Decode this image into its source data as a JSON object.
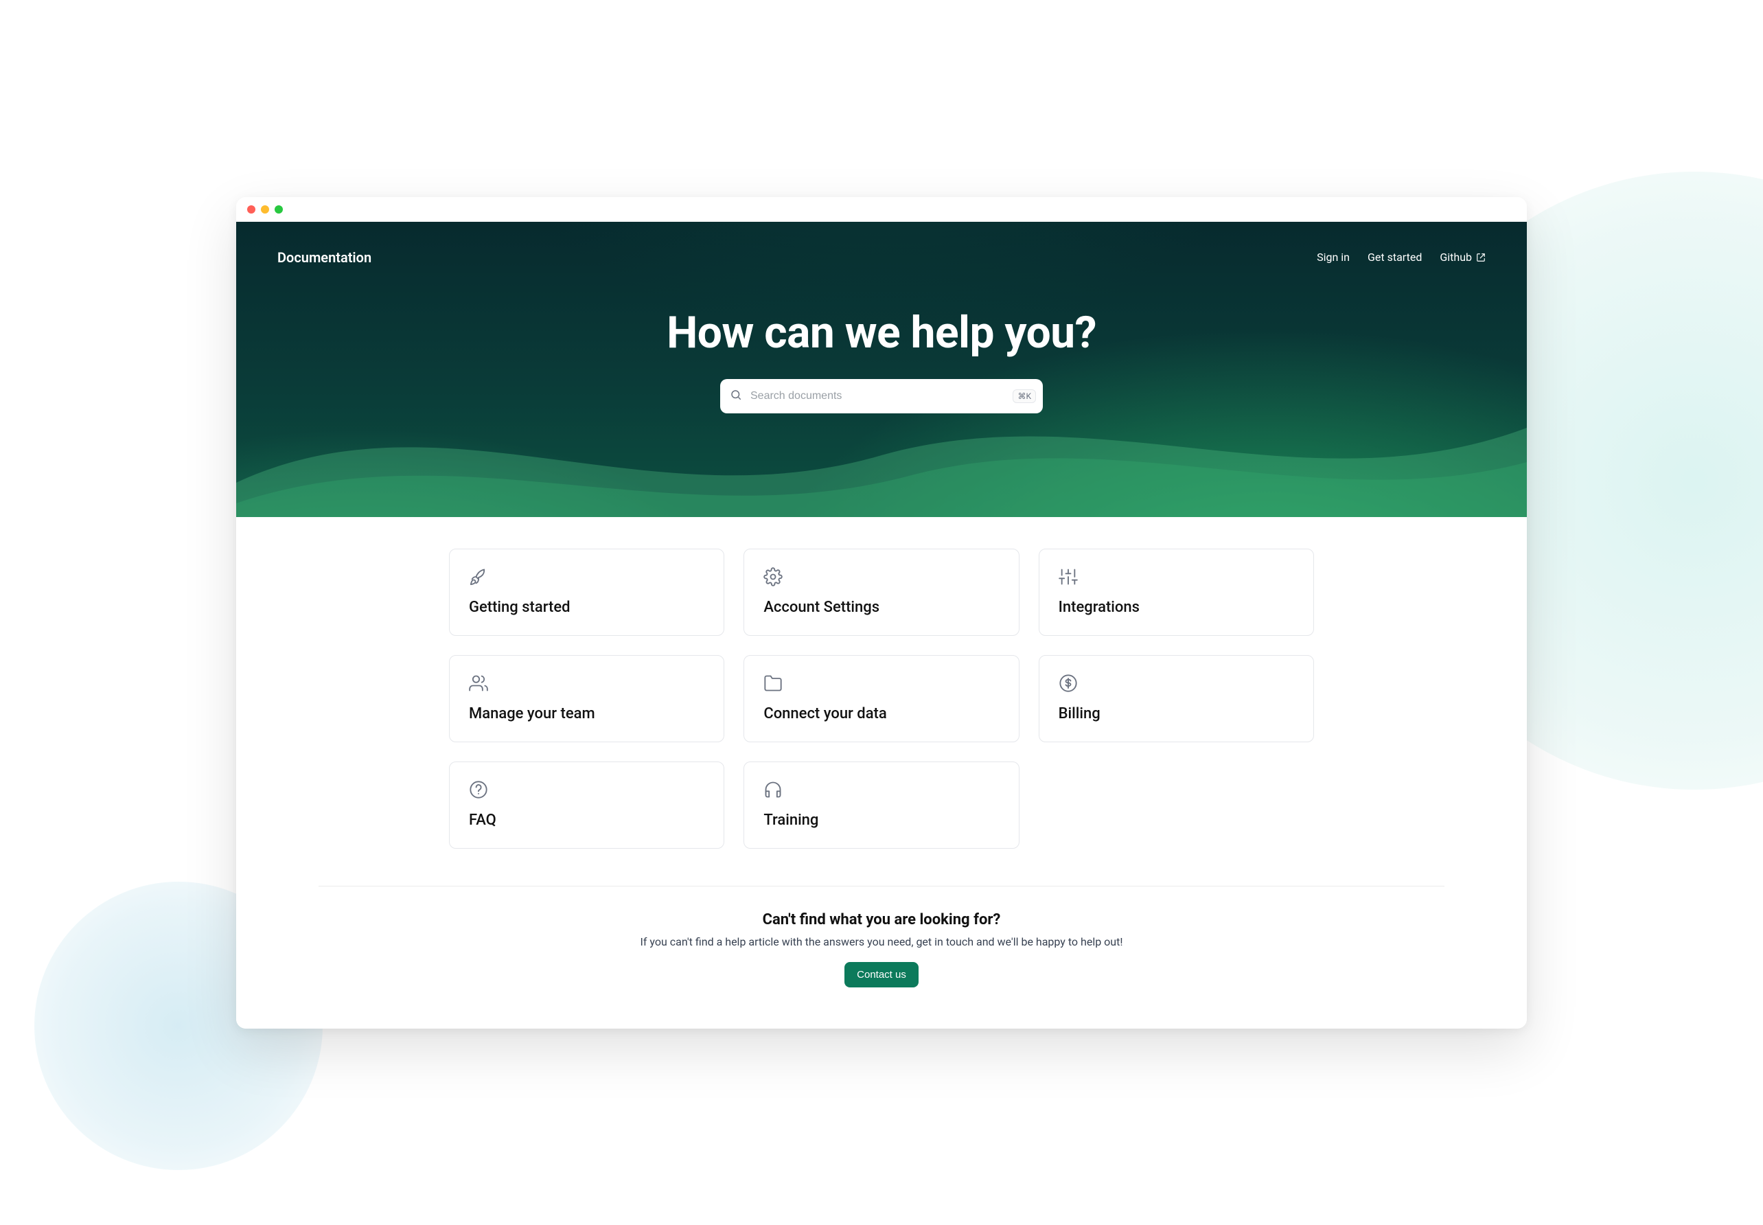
{
  "header": {
    "brand": "Documentation",
    "nav": {
      "signin": "Sign in",
      "get_started": "Get started",
      "github": "Github"
    }
  },
  "hero": {
    "title": "How can we help you?",
    "search_placeholder": "Search documents",
    "shortcut": "⌘K"
  },
  "cards": [
    {
      "id": "getting-started",
      "label": "Getting started",
      "icon": "rocket-icon"
    },
    {
      "id": "account-settings",
      "label": "Account Settings",
      "icon": "settings-icon"
    },
    {
      "id": "integrations",
      "label": "Integrations",
      "icon": "sliders-icon"
    },
    {
      "id": "manage-your-team",
      "label": "Manage your team",
      "icon": "users-icon"
    },
    {
      "id": "connect-your-data",
      "label": "Connect your data",
      "icon": "folder-icon"
    },
    {
      "id": "billing",
      "label": "Billing",
      "icon": "dollar-icon"
    },
    {
      "id": "faq",
      "label": "FAQ",
      "icon": "question-icon"
    },
    {
      "id": "training",
      "label": "Training",
      "icon": "headset-icon"
    }
  ],
  "cta": {
    "heading": "Can't find what you are looking for?",
    "text": "If you can't find a help article with the answers you need, get in touch and we'll be happy to help out!",
    "button": "Contact us"
  },
  "colors": {
    "accent": "#0c7a5b"
  }
}
